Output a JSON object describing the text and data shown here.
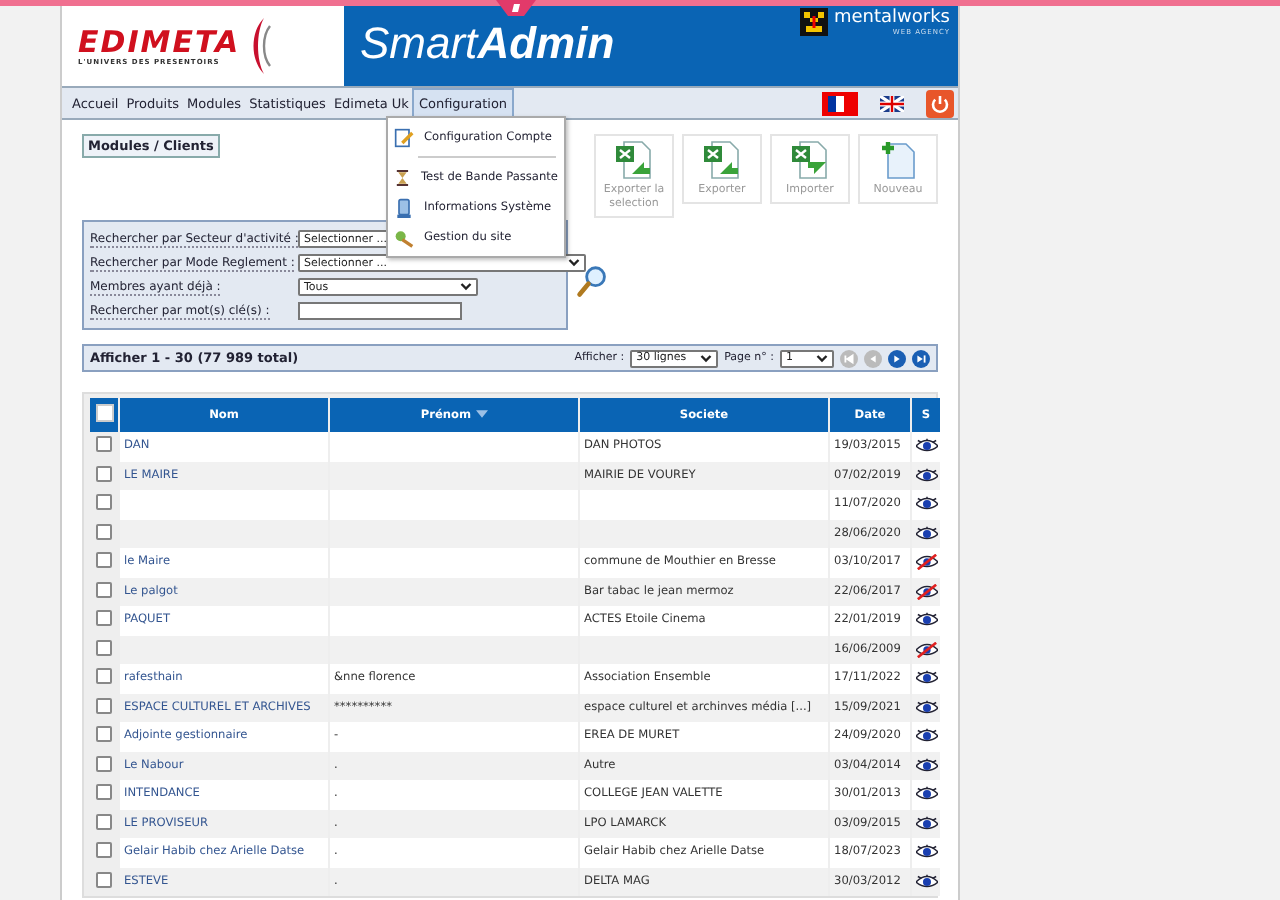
{
  "header": {
    "logo": "EDIMETA",
    "logo_tagline": "L'UNIVERS DES PRESENTOIRS",
    "app_title": "Smart**Admin**",
    "agency": "mentalworks",
    "agency_tagline": "WEB AGENCY"
  },
  "nav": {
    "items": [
      {
        "label": "Accueil",
        "selected": false
      },
      {
        "label": "Produits",
        "selected": false
      },
      {
        "label": "Modules",
        "selected": false
      },
      {
        "label": "Statistiques",
        "selected": false
      },
      {
        "label": "Edimeta Uk",
        "selected": false
      },
      {
        "label": "Configuration",
        "selected": true
      }
    ],
    "languages": [
      {
        "kind": "fr",
        "selected": true
      },
      {
        "kind": "en",
        "selected": false
      }
    ]
  },
  "dropdown": [
    {
      "label": "Configuration Compte",
      "kind": "edit"
    },
    {
      "kind": "separator"
    },
    {
      "label": "Test de Bande Passante",
      "kind": "hourglass"
    },
    {
      "label": "Informations Système",
      "kind": "computer"
    },
    {
      "label": "Gestion du site",
      "kind": "tools"
    }
  ],
  "breadcrumb": "Modules / Clients",
  "toolbar": [
    {
      "label": "Exporter la selection",
      "kind": "export"
    },
    {
      "label": "Exporter",
      "kind": "export"
    },
    {
      "label": "Importer",
      "kind": "import"
    },
    {
      "label": "Nouveau",
      "kind": "new"
    }
  ],
  "filters": [
    {
      "label": "Rechercher par Secteur d'activité :",
      "kind": "select",
      "value": "Selectionner ..."
    },
    {
      "label": "Rechercher par Mode Reglement :",
      "kind": "select",
      "value": "Selectionner ..."
    },
    {
      "label": "Membres ayant déjà :",
      "kind": "select",
      "value": "Tous"
    },
    {
      "label": "Rechercher par mot(s) clé(s) :",
      "kind": "text"
    }
  ],
  "pager": {
    "summary": "Afficher 1 - 30 (77 989 total)",
    "show_label": "Afficher :",
    "rows_per_page": "30 lignes",
    "page_label": "Page n° :",
    "page": "1"
  },
  "table": {
    "select_all_checked": false,
    "columns": [
      {
        "label": "Nom",
        "sorted": false
      },
      {
        "label": "Prénom",
        "sorted": true
      },
      {
        "label": "Societe",
        "sorted": false
      },
      {
        "label": "Date",
        "sorted": false
      },
      {
        "label": "S",
        "sorted": false
      }
    ],
    "rows": [
      {
        "nom": "DAN",
        "societe": "DAN PHOTOS",
        "date": "19/03/2015",
        "visible": true,
        "checked": false
      },
      {
        "nom": "LE MAIRE",
        "societe": "MAIRIE DE VOUREY",
        "date": "07/02/2019",
        "visible": true,
        "checked": false
      },
      {
        "date": "11/07/2020",
        "visible": true,
        "checked": false
      },
      {
        "date": "28/06/2020",
        "visible": true,
        "checked": false
      },
      {
        "nom": "le Maire",
        "societe": "commune de Mouthier en Bresse",
        "date": "03/10/2017",
        "visible": false,
        "checked": false
      },
      {
        "nom": "Le palgot",
        "societe": "Bar tabac le jean mermoz",
        "date": "22/06/2017",
        "visible": false,
        "checked": false
      },
      {
        "nom": "PAQUET",
        "societe": "ACTES Etoile Cinema",
        "date": "22/01/2019",
        "visible": true,
        "checked": false
      },
      {
        "date": "16/06/2009",
        "visible": false,
        "checked": false
      },
      {
        "nom": "rafesthain",
        "prenom": "&nne florence",
        "societe": "Association Ensemble",
        "date": "17/11/2022",
        "visible": true,
        "checked": false
      },
      {
        "nom": "ESPACE CULTUREL ET ARCHIVES",
        "prenom": "**********",
        "societe": "espace culturel et archinves média [...]",
        "date": "15/09/2021",
        "visible": true,
        "checked": false
      },
      {
        "nom": "Adjointe gestionnaire",
        "prenom": "-",
        "societe": "EREA DE MURET",
        "date": "24/09/2020",
        "visible": true,
        "checked": false
      },
      {
        "nom": "Le Nabour",
        "prenom": ".",
        "societe": "Autre",
        "date": "03/04/2014",
        "visible": true,
        "checked": false
      },
      {
        "nom": "INTENDANCE",
        "prenom": ".",
        "societe": "COLLEGE JEAN VALETTE",
        "date": "30/01/2013",
        "visible": true,
        "checked": false
      },
      {
        "nom": "LE PROVISEUR",
        "prenom": ".",
        "societe": "LPO LAMARCK",
        "date": "03/09/2015",
        "visible": true,
        "checked": false
      },
      {
        "nom": "Gelair Habib chez Arielle Datse",
        "prenom": ".",
        "societe": "Gelair Habib chez Arielle Datse",
        "date": "18/07/2023",
        "visible": true,
        "checked": false
      },
      {
        "nom": "ESTEVE",
        "prenom": ".",
        "societe": "DELTA MAG",
        "date": "30/03/2012",
        "visible": true,
        "checked": false
      }
    ]
  }
}
